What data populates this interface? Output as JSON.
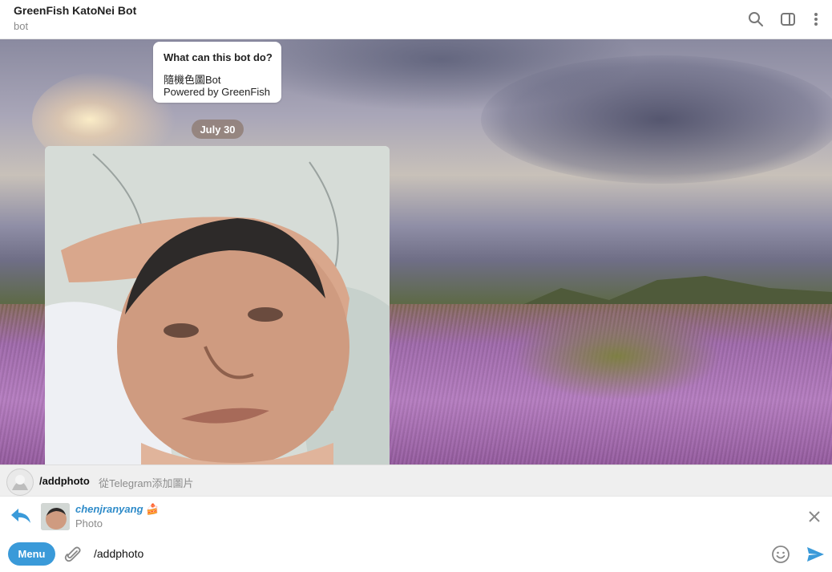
{
  "header": {
    "title": "GreenFish KatoNei Bot",
    "subtitle": "bot"
  },
  "bot_info": {
    "question": "What can this bot do?",
    "line1": "隨機色圖Bot",
    "line2": "Powered by GreenFish"
  },
  "date_separator": "July 30",
  "command_suggestion": {
    "command": "/addphoto",
    "description": "從Telegram添加圖片"
  },
  "reply_preview": {
    "name": "chenjranyang",
    "emoji": "🍰",
    "type": "Photo"
  },
  "composer": {
    "menu_label": "Menu",
    "input_text": "/addphoto"
  },
  "icons": [
    "search-icon",
    "sidebar-toggle-icon",
    "more-vertical-icon",
    "reply-arrow-icon",
    "close-icon",
    "attach-icon",
    "emoji-icon",
    "send-icon"
  ],
  "colors": {
    "accent": "#3a9ad9",
    "reply_name": "#2e8bc9"
  }
}
